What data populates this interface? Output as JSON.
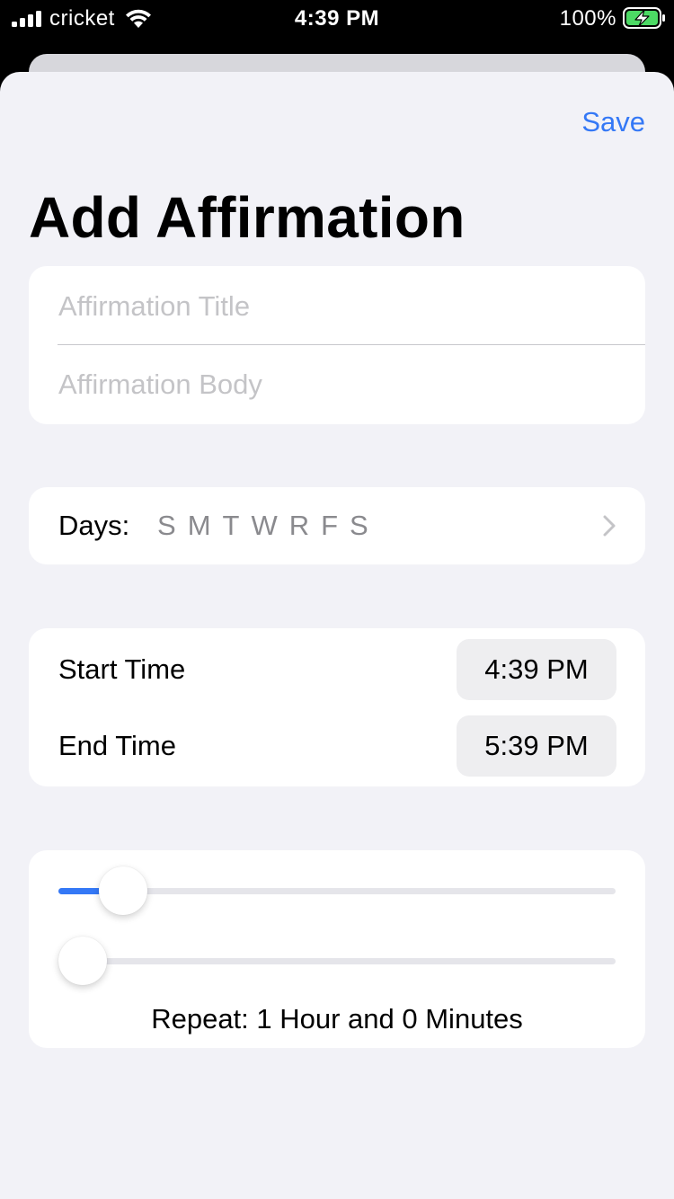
{
  "status_bar": {
    "carrier": "cricket",
    "time": "4:39 PM",
    "battery_percent": "100%",
    "icons": [
      "signal-icon",
      "wifi-icon",
      "battery-charging-icon"
    ]
  },
  "nav": {
    "save_label": "Save"
  },
  "title": "Add Affirmation",
  "form": {
    "title_field": {
      "placeholder": "Affirmation Title",
      "value": ""
    },
    "body_field": {
      "placeholder": "Affirmation Body",
      "value": ""
    }
  },
  "days": {
    "label": "Days:",
    "letters": [
      "S",
      "M",
      "T",
      "W",
      "R",
      "F",
      "S"
    ],
    "chevron_icon": "chevron-right-icon"
  },
  "times": {
    "start_label": "Start Time",
    "start_value": "4:39 PM",
    "end_label": "End Time",
    "end_value": "5:39 PM"
  },
  "repeat": {
    "hours_slider_fraction": 0.08,
    "minutes_slider_fraction": 0.0,
    "text": "Repeat: 1 Hour and 0 Minutes"
  },
  "colors": {
    "accent": "#3478f6",
    "background": "#f2f2f7",
    "card": "#ffffff",
    "secondary_text": "#8a8a8e"
  }
}
